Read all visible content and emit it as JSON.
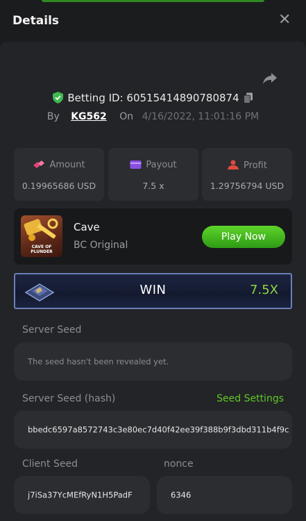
{
  "header": {
    "title": "Details",
    "close_glyph": "✕"
  },
  "bet": {
    "id_label": "Betting ID: 60515414890780874",
    "by_label": "By",
    "user": "KG562",
    "on_label": "On",
    "date": "4/16/2022, 11:01:16 PM"
  },
  "stats": {
    "amount": {
      "label": "Amount",
      "value": "0.19965686 USD",
      "icon": "coins-icon"
    },
    "payout": {
      "label": "Payout",
      "value": "7.5 x",
      "icon": "wallet-icon"
    },
    "profit": {
      "label": "Profit",
      "value": "1.29756794 USD",
      "icon": "profit-icon"
    }
  },
  "game": {
    "name": "Cave",
    "provider": "BC Original",
    "thumb_text": "CAVE OF PLUNDER",
    "play_label": "Play Now"
  },
  "result": {
    "label": "WIN",
    "multiplier": "7.5X"
  },
  "seeds": {
    "server_seed_label": "Server Seed",
    "server_seed_value": "The seed hasn't been revealed yet.",
    "server_hash_label": "Server Seed (hash)",
    "seed_settings_label": "Seed Settings",
    "server_hash_value": "bbedc6597a8572743c3e80ec7d40f42ee39f388b9f3dbd311b4f9c",
    "client_seed_label": "Client Seed",
    "client_seed_value": "j7iSa37YcMEfRyN1H5PadF",
    "nonce_label": "nonce",
    "nonce_value": "6346"
  },
  "colors": {
    "accent_green": "#5fc927",
    "win_green": "#8ed544",
    "panel": "#232427"
  }
}
